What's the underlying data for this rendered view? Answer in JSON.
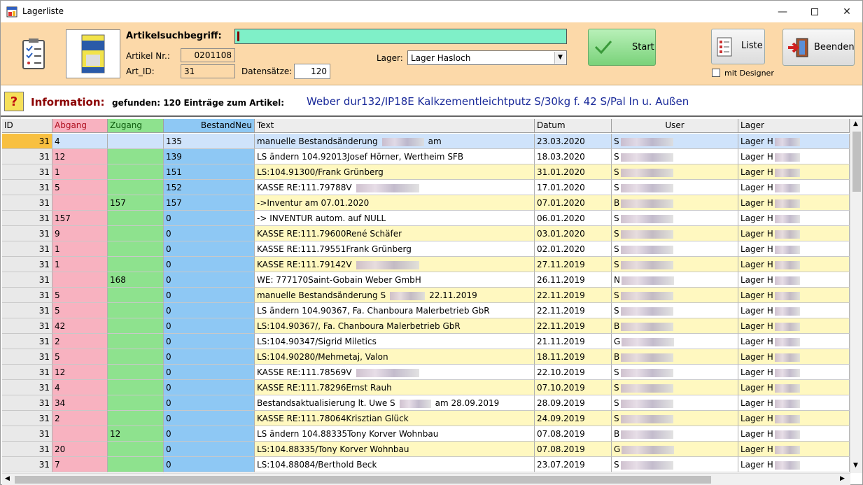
{
  "window": {
    "title": "Lagerliste"
  },
  "search": {
    "label": "Artikelsuchbegriff:",
    "value": "",
    "artikel_nr_label": "Artikel Nr.:",
    "artikel_nr": "0201108",
    "art_id_label": "Art_ID:",
    "art_id": "31",
    "datensaetze_label": "Datensätze:",
    "datensaetze": "120",
    "lager_label": "Lager:",
    "lager_value": "Lager Hasloch"
  },
  "buttons": {
    "start": "Start",
    "liste": "Liste",
    "beenden": "Beenden",
    "mit_designer": "mit Designer"
  },
  "info": {
    "label": "Information:",
    "found": "gefunden: 120 Einträge zum Artikel:",
    "article": "Weber dur132/IP18E Kalkzementleichtputz S/30kg f. 42 S/Pal In u. Außen"
  },
  "columns": [
    "ID",
    "Abgang",
    "Zugang",
    "BestandNeu",
    "Text",
    "Datum",
    "User",
    "Lager"
  ],
  "rows": [
    {
      "id": "31",
      "abgang": "4",
      "zugang": "",
      "bestand": "135",
      "text": "manuelle Bestandsänderung",
      "datum": "23.03.2020",
      "user": "S",
      "lager": "Lager H"
    },
    {
      "id": "31",
      "abgang": "12",
      "zugang": "",
      "bestand": "139",
      "text": "LS ändern 104.92013Josef Hörner, Wertheim SFB",
      "datum": "18.03.2020",
      "user": "S",
      "lager": "Lager H"
    },
    {
      "id": "31",
      "abgang": "1",
      "zugang": "",
      "bestand": "151",
      "text": "LS:104.91300/Frank Grünberg",
      "datum": "31.01.2020",
      "user": "S",
      "lager": "Lager H"
    },
    {
      "id": "31",
      "abgang": "5",
      "zugang": "",
      "bestand": "152",
      "text": "KASSE RE:111.79788V",
      "datum": "17.01.2020",
      "user": "S",
      "lager": "Lager H"
    },
    {
      "id": "31",
      "abgang": "",
      "zugang": "157",
      "bestand": "157",
      "text": "->Inventur am 07.01.2020",
      "datum": "07.01.2020",
      "user": "B",
      "lager": "Lager H"
    },
    {
      "id": "31",
      "abgang": "157",
      "zugang": "",
      "bestand": "0",
      "text": "-> INVENTUR autom. auf NULL",
      "datum": "06.01.2020",
      "user": "S",
      "lager": "Lager H"
    },
    {
      "id": "31",
      "abgang": "9",
      "zugang": "",
      "bestand": "0",
      "text": "KASSE RE:111.79600René Schäfer",
      "datum": "03.01.2020",
      "user": "S",
      "lager": "Lager H"
    },
    {
      "id": "31",
      "abgang": "1",
      "zugang": "",
      "bestand": "0",
      "text": "KASSE RE:111.79551Frank Grünberg",
      "datum": "02.01.2020",
      "user": "S",
      "lager": "Lager H"
    },
    {
      "id": "31",
      "abgang": "1",
      "zugang": "",
      "bestand": "0",
      "text": "KASSE RE:111.79142V",
      "datum": "27.11.2019",
      "user": "S",
      "lager": "Lager H"
    },
    {
      "id": "31",
      "abgang": "",
      "zugang": "168",
      "bestand": "0",
      "text": "WE: 777170Saint-Gobain Weber GmbH",
      "datum": "26.11.2019",
      "user": "N",
      "lager": "Lager H"
    },
    {
      "id": "31",
      "abgang": "5",
      "zugang": "",
      "bestand": "0",
      "text": "manuelle Bestandsänderung  S",
      "datum": "22.11.2019",
      "user": "S",
      "lager": "Lager H"
    },
    {
      "id": "31",
      "abgang": "5",
      "zugang": "",
      "bestand": "0",
      "text": "LS ändern 104.90367, Fa. Chanboura Malerbetrieb GbR",
      "datum": "22.11.2019",
      "user": "S",
      "lager": "Lager H"
    },
    {
      "id": "31",
      "abgang": "42",
      "zugang": "",
      "bestand": "0",
      "text": "LS:104.90367/, Fa. Chanboura Malerbetrieb GbR",
      "datum": "22.11.2019",
      "user": "B",
      "lager": "Lager H"
    },
    {
      "id": "31",
      "abgang": "2",
      "zugang": "",
      "bestand": "0",
      "text": "LS:104.90347/Sigrid Miletics",
      "datum": "21.11.2019",
      "user": "G",
      "lager": "Lager H"
    },
    {
      "id": "31",
      "abgang": "5",
      "zugang": "",
      "bestand": "0",
      "text": "LS:104.90280/Mehmetaj, Valon",
      "datum": "18.11.2019",
      "user": "B",
      "lager": "Lager H"
    },
    {
      "id": "31",
      "abgang": "12",
      "zugang": "",
      "bestand": "0",
      "text": "KASSE RE:111.78569V",
      "datum": "22.10.2019",
      "user": "S",
      "lager": "Lager H"
    },
    {
      "id": "31",
      "abgang": "4",
      "zugang": "",
      "bestand": "0",
      "text": "KASSE RE:111.78296Ernst Rauh",
      "datum": "07.10.2019",
      "user": "S",
      "lager": "Lager H"
    },
    {
      "id": "31",
      "abgang": "34",
      "zugang": "",
      "bestand": "0",
      "text": "Bestandsaktualisierung lt. Uwe  S",
      "datum": "28.09.2019",
      "user": "S",
      "lager": "Lager H"
    },
    {
      "id": "31",
      "abgang": "2",
      "zugang": "",
      "bestand": "0",
      "text": "KASSE RE:111.78064Krisztian Glück",
      "datum": "24.09.2019",
      "user": "S",
      "lager": "Lager H"
    },
    {
      "id": "31",
      "abgang": "",
      "zugang": "12",
      "bestand": "0",
      "text": "LS ändern 104.88335Tony Korver Wohnbau",
      "datum": "07.08.2019",
      "user": "B",
      "lager": "Lager H"
    },
    {
      "id": "31",
      "abgang": "20",
      "zugang": "",
      "bestand": "0",
      "text": "LS:104.88335/Tony Korver Wohnbau",
      "datum": "07.08.2019",
      "user": "G",
      "lager": "Lager H"
    },
    {
      "id": "31",
      "abgang": "7",
      "zugang": "",
      "bestand": "0",
      "text": "LS:104.88084/Berthold Beck",
      "datum": "23.07.2019",
      "user": "S",
      "lager": "Lager H"
    }
  ],
  "text_suffix": {
    "0": "am",
    "10": "22.11.2019",
    "17": "am    28.09.2019"
  },
  "colors": {
    "panel": "#fcd9a9",
    "abgang": "#f8b2c0",
    "zugang": "#8ee28e",
    "bestand": "#8ec8f4",
    "row_highlight": "#fff8c0",
    "selected": "#cfe3fb"
  }
}
